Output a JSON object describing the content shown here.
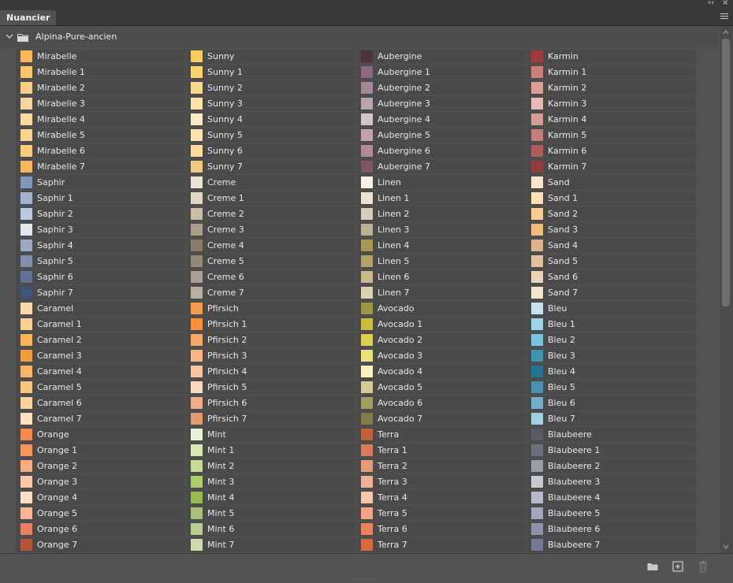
{
  "panel": {
    "tab_label": "Nuancier",
    "collapse_glyph": "‹‹",
    "close_glyph": "×",
    "menu_icon": "panel-menu-icon"
  },
  "group": {
    "name": "Alpina-Pure-ancien",
    "expanded": true
  },
  "columns": [
    [
      {
        "name": "Mirabelle",
        "color": "#F8B85A"
      },
      {
        "name": "Mirabelle 1",
        "color": "#F9C56A"
      },
      {
        "name": "Mirabelle 2",
        "color": "#F6CE88"
      },
      {
        "name": "Mirabelle 3",
        "color": "#F5D5A5"
      },
      {
        "name": "Mirabelle 4",
        "color": "#F8D99E"
      },
      {
        "name": "Mirabelle 5",
        "color": "#F8D691"
      },
      {
        "name": "Mirabelle 6",
        "color": "#F9CC7E"
      },
      {
        "name": "Mirabelle 7",
        "color": "#F6B560"
      },
      {
        "name": "Saphir",
        "color": "#7F96BD"
      },
      {
        "name": "Saphir 1",
        "color": "#A0B2D0"
      },
      {
        "name": "Saphir 2",
        "color": "#BCC9E0"
      },
      {
        "name": "Saphir 3",
        "color": "#E2E7F2"
      },
      {
        "name": "Saphir 4",
        "color": "#9CA9C0"
      },
      {
        "name": "Saphir 5",
        "color": "#7F90AE"
      },
      {
        "name": "Saphir 6",
        "color": "#5F7394"
      },
      {
        "name": "Saphir 7",
        "color": "#3E5478"
      },
      {
        "name": "Caramel",
        "color": "#FCD8A8"
      },
      {
        "name": "Caramel 1",
        "color": "#FCD092"
      },
      {
        "name": "Caramel 2",
        "color": "#F8B55A"
      },
      {
        "name": "Caramel 3",
        "color": "#EE9E3F"
      },
      {
        "name": "Caramel 4",
        "color": "#F6B566"
      },
      {
        "name": "Caramel 5",
        "color": "#F8C583"
      },
      {
        "name": "Caramel 6",
        "color": "#FAD4A0"
      },
      {
        "name": "Caramel 7",
        "color": "#FCE2BD"
      },
      {
        "name": "Orange",
        "color": "#F38A4E"
      },
      {
        "name": "Orange 1",
        "color": "#F6965D"
      },
      {
        "name": "Orange 2",
        "color": "#F7AD80"
      },
      {
        "name": "Orange 3",
        "color": "#F9C9A8"
      },
      {
        "name": "Orange 4",
        "color": "#FBDCC6"
      },
      {
        "name": "Orange 5",
        "color": "#F9B596"
      },
      {
        "name": "Orange 6",
        "color": "#E68060"
      },
      {
        "name": "Orange 7",
        "color": "#B4553A"
      }
    ],
    [
      {
        "name": "Sunny",
        "color": "#F9CC63"
      },
      {
        "name": "Sunny 1",
        "color": "#FAD270"
      },
      {
        "name": "Sunny 2",
        "color": "#FAD98A"
      },
      {
        "name": "Sunny 3",
        "color": "#FBE2A7"
      },
      {
        "name": "Sunny 4",
        "color": "#FCEBC4"
      },
      {
        "name": "Sunny 5",
        "color": "#FBE4B0"
      },
      {
        "name": "Sunny 6",
        "color": "#F9DB9E"
      },
      {
        "name": "Sunny 7",
        "color": "#F2C887"
      },
      {
        "name": "Creme",
        "color": "#EEE3D5"
      },
      {
        "name": "Creme 1",
        "color": "#E3D5C3"
      },
      {
        "name": "Creme 2",
        "color": "#CCBBA8"
      },
      {
        "name": "Creme 3",
        "color": "#AE9D8A"
      },
      {
        "name": "Creme 4",
        "color": "#8C7B6B"
      },
      {
        "name": "Creme 5",
        "color": "#958878"
      },
      {
        "name": "Creme 6",
        "color": "#AA9F92"
      },
      {
        "name": "Creme 7",
        "color": "#B9AFA3"
      },
      {
        "name": "Pfirsich",
        "color": "#F79A4A"
      },
      {
        "name": "Pfirsich 1",
        "color": "#F8913A"
      },
      {
        "name": "Pfirsich 2",
        "color": "#F9A866"
      },
      {
        "name": "Pfirsich 3",
        "color": "#FAB587"
      },
      {
        "name": "Pfirsich 4",
        "color": "#FAC69F"
      },
      {
        "name": "Pfirsich 5",
        "color": "#FBD8C0"
      },
      {
        "name": "Pfirsich 6",
        "color": "#EDB08A"
      },
      {
        "name": "Pfirsich 7",
        "color": "#E19A6E"
      },
      {
        "name": "Mint",
        "color": "#E8F1D8"
      },
      {
        "name": "Mint 1",
        "color": "#D8E8B5"
      },
      {
        "name": "Mint 2",
        "color": "#C7DE97"
      },
      {
        "name": "Mint 3",
        "color": "#ABCC6F"
      },
      {
        "name": "Mint 4",
        "color": "#98BA51"
      },
      {
        "name": "Mint 5",
        "color": "#A6C27A"
      },
      {
        "name": "Mint 6",
        "color": "#B7CE95"
      },
      {
        "name": "Mint 7",
        "color": "#CCDCAE"
      }
    ],
    [
      {
        "name": "Aubergine",
        "color": "#4B3440"
      },
      {
        "name": "Aubergine 1",
        "color": "#8E6A7E"
      },
      {
        "name": "Aubergine 2",
        "color": "#A58797"
      },
      {
        "name": "Aubergine 3",
        "color": "#BCA3B0"
      },
      {
        "name": "Aubergine 4",
        "color": "#D6C3CC"
      },
      {
        "name": "Aubergine 5",
        "color": "#C4A2B0"
      },
      {
        "name": "Aubergine 6",
        "color": "#B38897"
      },
      {
        "name": "Aubergine 7",
        "color": "#805566"
      },
      {
        "name": "Linen",
        "color": "#F8F2E6"
      },
      {
        "name": "Linen 1",
        "color": "#EAE2D2"
      },
      {
        "name": "Linen 2",
        "color": "#D6CDB9"
      },
      {
        "name": "Linen 3",
        "color": "#BDB095"
      },
      {
        "name": "Linen 4",
        "color": "#A89856"
      },
      {
        "name": "Linen 5",
        "color": "#B3A36A"
      },
      {
        "name": "Linen 6",
        "color": "#C9B98D"
      },
      {
        "name": "Linen 7",
        "color": "#DDD1B1"
      },
      {
        "name": "Avocado",
        "color": "#9E9742"
      },
      {
        "name": "Avocado 1",
        "color": "#C8BE3F"
      },
      {
        "name": "Avocado 2",
        "color": "#DCD053"
      },
      {
        "name": "Avocado 3",
        "color": "#E9E07F"
      },
      {
        "name": "Avocado 4",
        "color": "#F7F2BE"
      },
      {
        "name": "Avocado 5",
        "color": "#D4CB99"
      },
      {
        "name": "Avocado 6",
        "color": "#A59D67"
      },
      {
        "name": "Avocado 7",
        "color": "#847C48"
      },
      {
        "name": "Terra",
        "color": "#C0613E"
      },
      {
        "name": "Terra 1",
        "color": "#D57D5D"
      },
      {
        "name": "Terra 2",
        "color": "#E49A7B"
      },
      {
        "name": "Terra 3",
        "color": "#EEB296"
      },
      {
        "name": "Terra 4",
        "color": "#F6C7AE"
      },
      {
        "name": "Terra 5",
        "color": "#F2A587"
      },
      {
        "name": "Terra 6",
        "color": "#E7845E"
      },
      {
        "name": "Terra 7",
        "color": "#D86A3F"
      }
    ],
    [
      {
        "name": "Karmin",
        "color": "#A23B3C"
      },
      {
        "name": "Karmin 1",
        "color": "#D07E7B"
      },
      {
        "name": "Karmin 2",
        "color": "#DD9E9A"
      },
      {
        "name": "Karmin 3",
        "color": "#E6BBB6"
      },
      {
        "name": "Karmin 4",
        "color": "#D49D99"
      },
      {
        "name": "Karmin 5",
        "color": "#C2807C"
      },
      {
        "name": "Karmin 6",
        "color": "#AD5C5A"
      },
      {
        "name": "Karmin 7",
        "color": "#923E3E"
      },
      {
        "name": "Sand",
        "color": "#F7E6C9"
      },
      {
        "name": "Sand 1",
        "color": "#FAE0B5"
      },
      {
        "name": "Sand 2",
        "color": "#F8CE92"
      },
      {
        "name": "Sand 3",
        "color": "#F0BC7A"
      },
      {
        "name": "Sand 4",
        "color": "#DDB38C"
      },
      {
        "name": "Sand 5",
        "color": "#E3C39E"
      },
      {
        "name": "Sand 6",
        "color": "#EBD5B8"
      },
      {
        "name": "Sand 7",
        "color": "#F2E4CF"
      },
      {
        "name": "Bleu",
        "color": "#C4E3EE"
      },
      {
        "name": "Bleu 1",
        "color": "#9CD6EA"
      },
      {
        "name": "Bleu 2",
        "color": "#79C2E0"
      },
      {
        "name": "Bleu 3",
        "color": "#3F93AD"
      },
      {
        "name": "Bleu 4",
        "color": "#23728F"
      },
      {
        "name": "Bleu 5",
        "color": "#4C90B1"
      },
      {
        "name": "Bleu 6",
        "color": "#74AECB"
      },
      {
        "name": "Bleu 7",
        "color": "#A4CFE3"
      },
      {
        "name": "Blaubeere",
        "color": "#5A5A66"
      },
      {
        "name": "Blaubeere 1",
        "color": "#6E6F7E"
      },
      {
        "name": "Blaubeere 2",
        "color": "#9B9CAA"
      },
      {
        "name": "Blaubeere 3",
        "color": "#C8C9D4"
      },
      {
        "name": "Blaubeere 4",
        "color": "#B9BBCB"
      },
      {
        "name": "Blaubeere 5",
        "color": "#A4A7BD"
      },
      {
        "name": "Blaubeere 6",
        "color": "#8E92AA"
      },
      {
        "name": "Blaubeere 7",
        "color": "#757A93"
      }
    ]
  ],
  "footer": {
    "icons": [
      "new-group-folder-icon",
      "new-swatch-icon",
      "trash-icon"
    ]
  }
}
